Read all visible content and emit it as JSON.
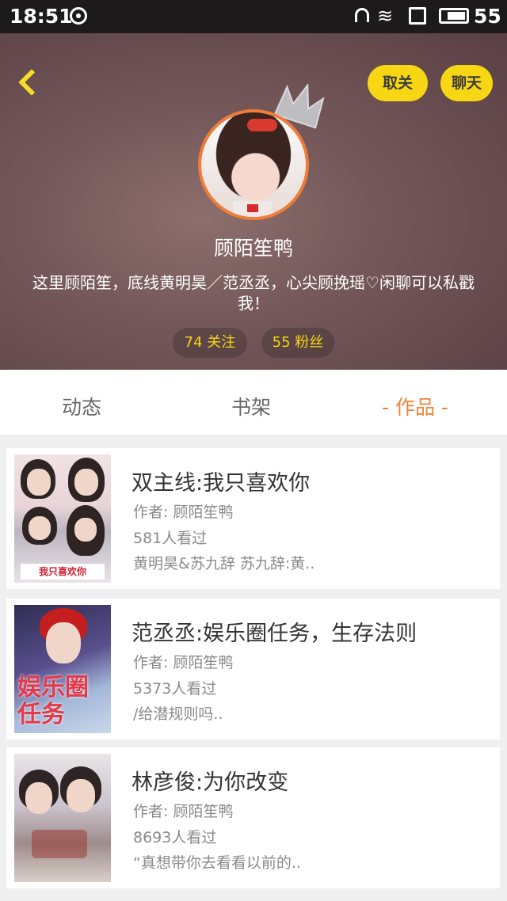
{
  "status_bar": {
    "time": "18:51",
    "battery": "55"
  },
  "header": {
    "unfollow_label": "取关",
    "chat_label": "聊天",
    "nickname": "顾陌笙鸭",
    "bio": "这里顾陌笙，底线黄明昊／范丞丞，心尖顾挽瑶♡闲聊可以私戳我！",
    "follow_label": "74 关注",
    "fans_label": "55 粉丝"
  },
  "tabs": [
    {
      "label": "动态"
    },
    {
      "label": "书架"
    },
    {
      "label": "- 作品 -"
    }
  ],
  "works": [
    {
      "title": "双主线:我只喜欢你",
      "author": "作者: 顾陌笙鸭",
      "views": "581人看过",
      "desc": "黄明昊&苏九辞 苏九辞:黄..",
      "cover_text": "我只喜欢你"
    },
    {
      "title": "范丞丞:娱乐圈任务，生存法则",
      "author": "作者: 顾陌笙鸭",
      "views": "5373人看过",
      "desc": "/给潜规则吗..",
      "cover_text": "娱乐圈任务"
    },
    {
      "title": "林彦俊:为你改变",
      "author": "作者: 顾陌笙鸭",
      "views": "8693人看过",
      "desc": "“真想带你去看看以前的..",
      "cover_text": ""
    }
  ],
  "colors": {
    "accent": "#f7d713",
    "tab_active": "#f0853a",
    "avatar_ring": "#f07c3a"
  },
  "icons": {
    "back": "chevron-left-icon",
    "crown": "crown-icon"
  }
}
